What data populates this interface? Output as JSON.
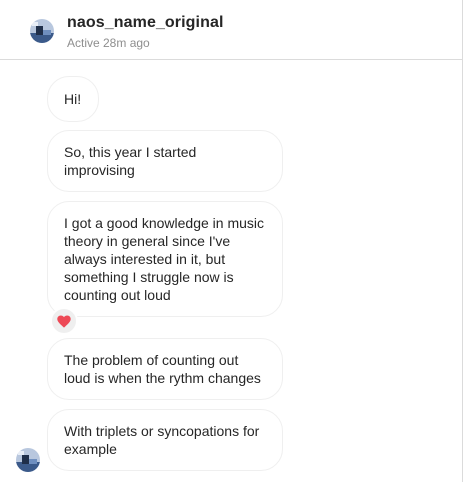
{
  "header": {
    "username": "naos_name_original",
    "status": "Active 28m ago"
  },
  "messages": [
    {
      "text": "Hi!"
    },
    {
      "text": "So, this year I started improvising"
    },
    {
      "text": "I got a good knowledge in music theory in general since I've always interested in it, but something I struggle now is counting out loud",
      "reaction": "heart-icon"
    },
    {
      "text": "The problem of counting out loud is when the rythm changes"
    },
    {
      "text": "With triplets or syncopations for example"
    }
  ],
  "colors": {
    "reaction_heart": "#ed4956",
    "border": "#dbdbdb",
    "secondary_text": "#8e8e8e"
  }
}
